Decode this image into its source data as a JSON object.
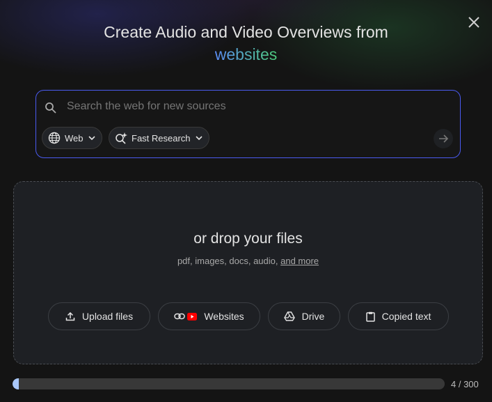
{
  "header": {
    "title_line1": "Create Audio and Video Overviews from",
    "title_highlight": "websites"
  },
  "search": {
    "placeholder": "Search the web for new sources",
    "source_chip": "Web",
    "mode_chip": "Fast Research"
  },
  "dropzone": {
    "heading": "or drop your files",
    "subtext": "pdf, images, docs, audio,",
    "more_link": "and more",
    "buttons": [
      "Upload files",
      "Websites",
      "Drive",
      "Copied text"
    ]
  },
  "sources": {
    "used": 4,
    "limit": 300,
    "label": "4 / 300"
  },
  "colors": {
    "accent": "#4a5bf0",
    "progress": "#a8c7fa",
    "youtube": "#ff0000"
  }
}
